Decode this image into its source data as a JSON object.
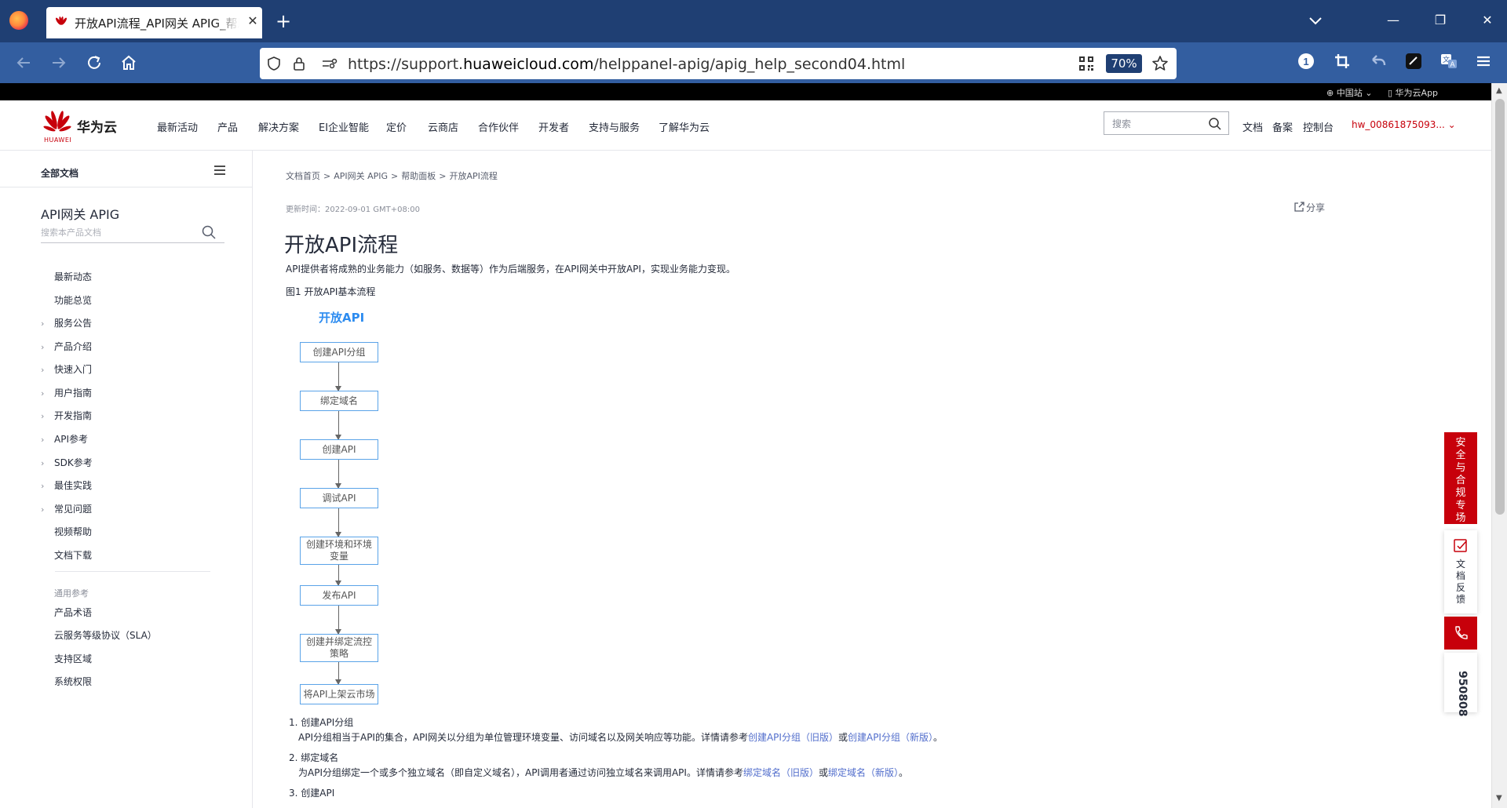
{
  "browser": {
    "tab_title": "开放API流程_API网关 APIG_帮助面板",
    "tab_close": "✕",
    "new_tab": "+",
    "url_host_prefix": "https://support.",
    "url_host": "huaweicloud.com",
    "url_path": "/helppanel-apig/apig_help_second04.html",
    "zoom": "70%",
    "win_min": "—",
    "win_max": "❐",
    "win_close": "✕"
  },
  "topstrip": {
    "region": "⊕ 中国站 ⌄",
    "app": "▯ 华为云App"
  },
  "header": {
    "logo_name": "华为云",
    "logo_sub": "HUAWEI",
    "nav": [
      "最新活动",
      "产品",
      "解决方案",
      "EI企业智能",
      "定价",
      "云商店",
      "合作伙伴",
      "开发者",
      "支持与服务",
      "了解华为云"
    ],
    "search_placeholder": "搜索",
    "links": [
      "文档",
      "备案",
      "控制台"
    ],
    "user": "hw_00861875093... ⌄"
  },
  "sidebar": {
    "all_docs": "全部文档",
    "product": "API网关 APIG",
    "search_placeholder": "搜索本产品文档",
    "items": [
      {
        "label": "最新动态",
        "chev": ""
      },
      {
        "label": "功能总览",
        "chev": ""
      },
      {
        "label": "服务公告",
        "chev": "›"
      },
      {
        "label": "产品介绍",
        "chev": "›"
      },
      {
        "label": "快速入门",
        "chev": "›"
      },
      {
        "label": "用户指南",
        "chev": "›"
      },
      {
        "label": "开发指南",
        "chev": "›"
      },
      {
        "label": "API参考",
        "chev": "›"
      },
      {
        "label": "SDK参考",
        "chev": "›"
      },
      {
        "label": "最佳实践",
        "chev": "›"
      },
      {
        "label": "常见问题",
        "chev": "›"
      },
      {
        "label": "视频帮助",
        "chev": ""
      },
      {
        "label": "文档下载",
        "chev": ""
      }
    ],
    "common_label": "通用参考",
    "common_items": [
      "产品术语",
      "云服务等级协议（SLA）",
      "支持区域",
      "系统权限"
    ]
  },
  "content": {
    "breadcrumb": [
      "文档首页",
      "API网关 APIG",
      "帮助面板",
      "开放API流程"
    ],
    "breadcrumb_sep": ">",
    "update_time": "更新时间：2022-09-01 GMT+08:00",
    "share": "分享",
    "title": "开放API流程",
    "intro": "API提供者将成熟的业务能力（如服务、数据等）作为后端服务，在API网关中开放API，实现业务能力变现。",
    "figure_caption": "图1 开放API基本流程",
    "flow_title": "开放API",
    "flow_steps": [
      "创建API分组",
      "绑定域名",
      "创建API",
      "调试API",
      "创建环境和环境变量",
      "发布API",
      "创建并绑定流控策略",
      "将API上架云市场"
    ],
    "steps": [
      {
        "title": "1. 创建API分组",
        "desc": "API分组相当于API的集合，API网关以分组为单位管理环境变量、访问域名以及网关响应等功能。详情请参考",
        "link1": "创建API分组（旧版）",
        "mid": "或",
        "link2": "创建API分组（新版）",
        "end": "。"
      },
      {
        "title": "2. 绑定域名",
        "desc": "为API分组绑定一个或多个独立域名（即自定义域名），API调用者通过访问独立域名来调用API。详情请参考",
        "link1": "绑定域名（旧版）",
        "mid": "或",
        "link2": "绑定域名（新版）",
        "end": "。"
      },
      {
        "title": "3. 创建API"
      }
    ]
  },
  "floating": {
    "security": [
      "安",
      "全",
      "与",
      "合",
      "规",
      "专",
      "场"
    ],
    "feedback": [
      "文",
      "档",
      "反",
      "馈"
    ],
    "hotline": "950808"
  },
  "colors": {
    "brand_red": "#c7000b",
    "link_blue": "#526ecc",
    "flow_blue": "#2d8cf0",
    "browser_dark": "#1f3f73",
    "browser_nav": "#335ea0"
  }
}
